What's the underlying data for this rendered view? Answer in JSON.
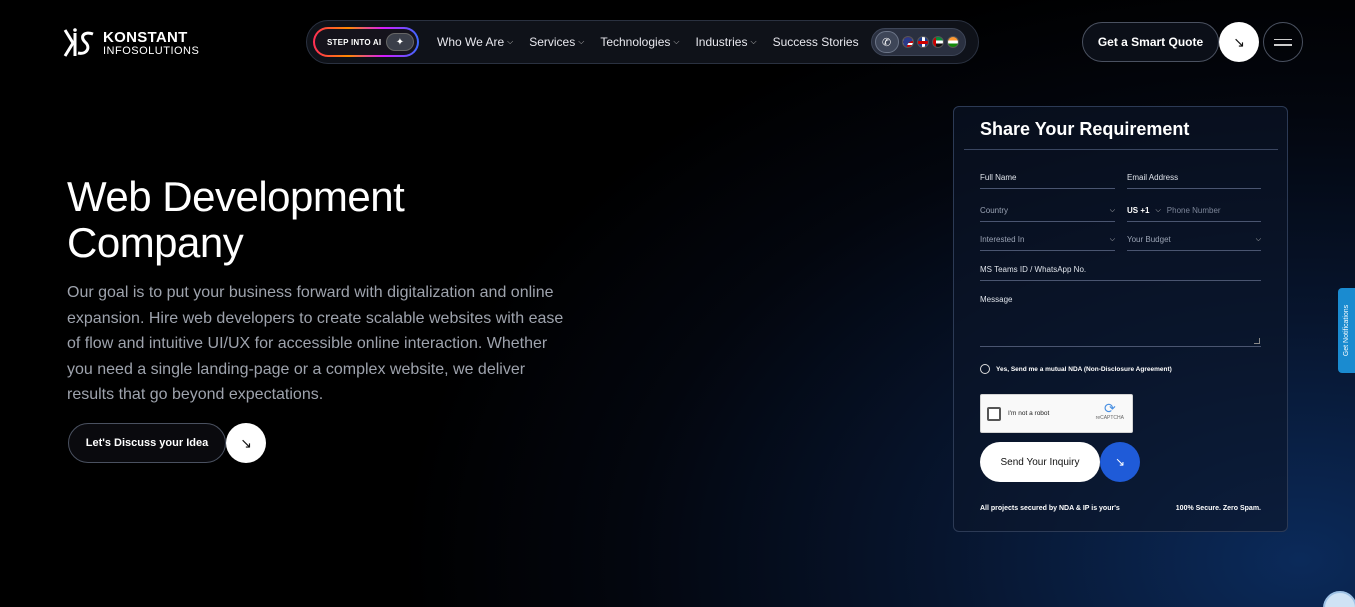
{
  "header": {
    "logo_line1": "KONSTANT",
    "logo_line2": "INFOSOLUTIONS",
    "ai_pill_label": "STEP INTO AI",
    "nav_items": [
      {
        "label": "Who We Are"
      },
      {
        "label": "Services"
      },
      {
        "label": "Technologies"
      },
      {
        "label": "Industries"
      },
      {
        "label": "Success Stories"
      }
    ],
    "quote_button": "Get a Smart Quote"
  },
  "hero": {
    "title_line1": "Web Development",
    "title_line2": "Company",
    "description": "Our goal is to put your business forward with digitalization and online expansion. Hire web developers to create scalable websites with ease of flow and intuitive UI/UX for accessible online interaction. Whether you need a single landing-page or a complex website, we deliver results that go beyond expectations.",
    "cta_label": "Let's Discuss your Idea"
  },
  "form": {
    "title": "Share Your Requirement",
    "full_name": "Full Name",
    "email": "Email Address",
    "country": "Country",
    "phone_code": "US +1",
    "phone_placeholder": "Phone Number",
    "interested_in": "Interested In",
    "budget": "Your Budget",
    "ms_teams": "MS Teams ID / WhatsApp No.",
    "message": "Message",
    "nda_label": "Yes, Send me a mutual NDA (Non-Disclosure Agreement)",
    "captcha_label": "I'm not a robot",
    "captcha_brand": "reCAPTCHA",
    "submit_label": "Send Your Inquiry",
    "footer_left": "All projects secured by NDA & IP is your's",
    "footer_right": "100% Secure. Zero Spam."
  },
  "side": {
    "notifications_label": "Get Notifications"
  }
}
